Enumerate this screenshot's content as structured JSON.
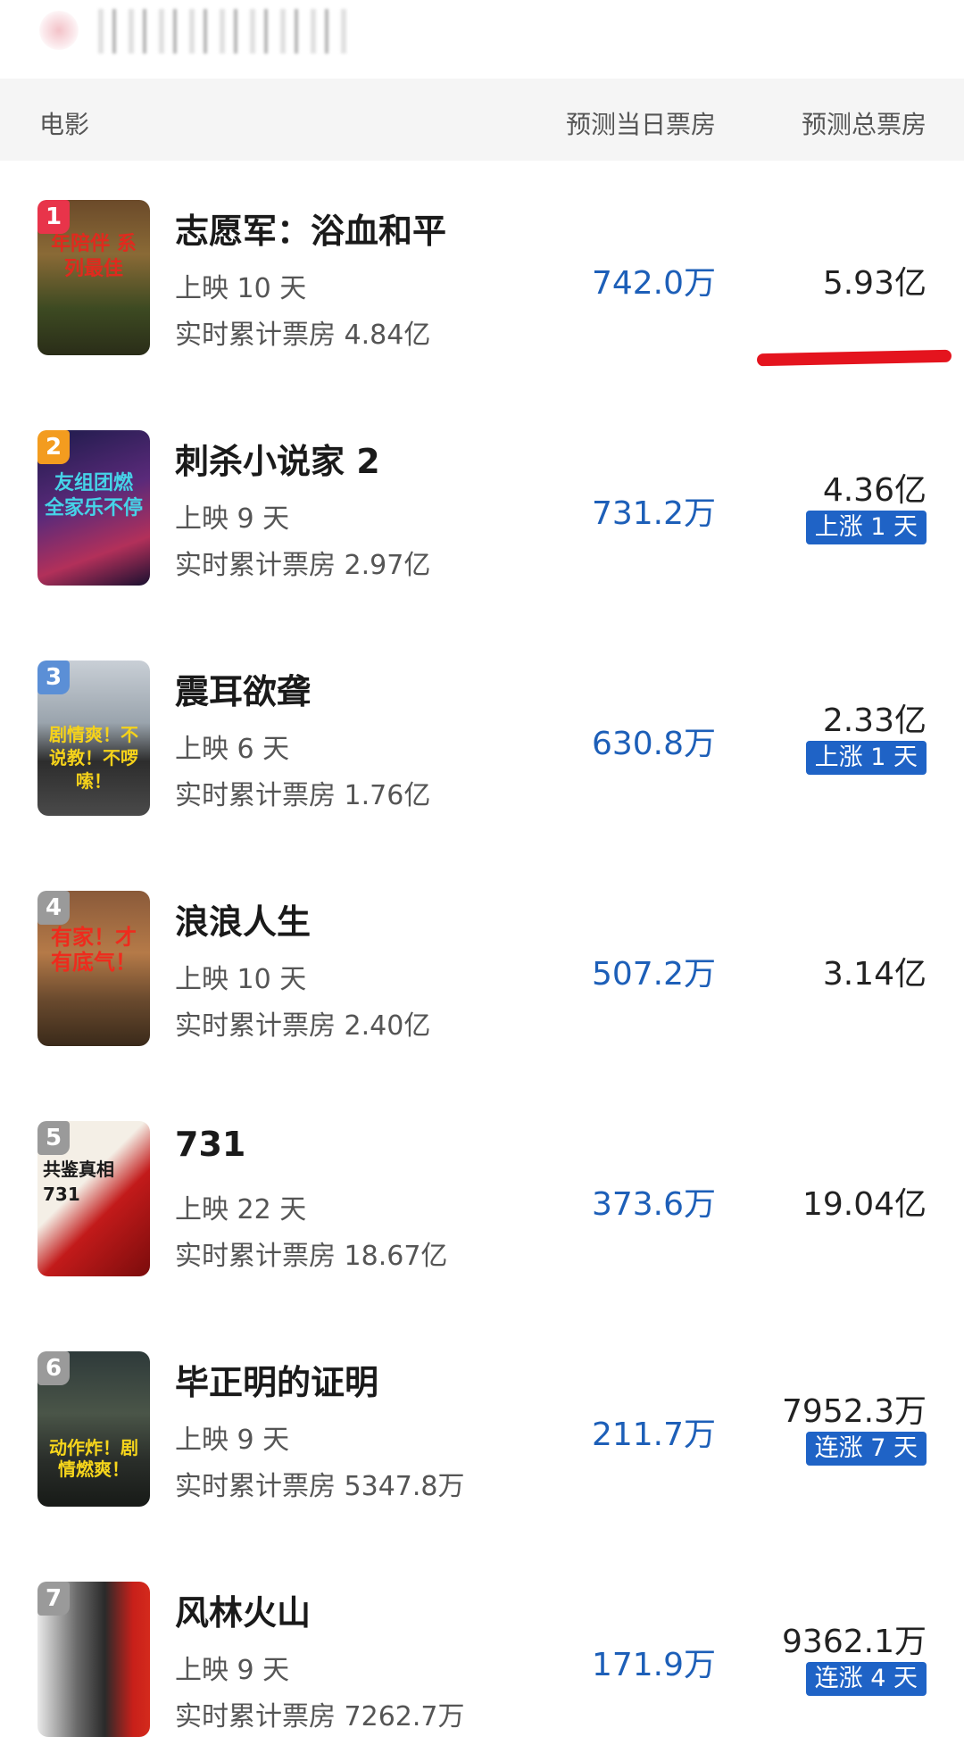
{
  "header": {
    "movie": "电影",
    "daily": "预测当日票房",
    "total": "预测总票房"
  },
  "colors": {
    "daily_value": "#1d5fb8",
    "badge_bg": "#1f63c6",
    "rank1": "#e8344a",
    "rank2": "#f39c1f",
    "rank3": "#5b8fd6",
    "rank_other": "#9a9a9a",
    "highlight_line": "#e4141e"
  },
  "movies": [
    {
      "rank": "1",
      "title": "志愿军：浴血和平",
      "days": "上映 10 天",
      "cum": "实时累计票房 4.84亿",
      "daily": "742.0万",
      "total": "5.93亿",
      "badge": "",
      "poster_text": "年陪伴 系列最佳"
    },
    {
      "rank": "2",
      "title": "刺杀小说家 2",
      "days": "上映 9 天",
      "cum": "实时累计票房 2.97亿",
      "daily": "731.2万",
      "total": "4.36亿",
      "badge": "上涨 1 天",
      "poster_text": "友组团燃 全家乐不停"
    },
    {
      "rank": "3",
      "title": "震耳欲聋",
      "days": "上映 6 天",
      "cum": "实时累计票房 1.76亿",
      "daily": "630.8万",
      "total": "2.33亿",
      "badge": "上涨 1 天",
      "poster_text": "剧情爽！不说教！不啰嗦！"
    },
    {
      "rank": "4",
      "title": "浪浪人生",
      "days": "上映 10 天",
      "cum": "实时累计票房 2.40亿",
      "daily": "507.2万",
      "total": "3.14亿",
      "badge": "",
      "poster_text": "有家！才有底气！"
    },
    {
      "rank": "5",
      "title": "731",
      "days": "上映 22 天",
      "cum": "实时累计票房 18.67亿",
      "daily": "373.6万",
      "total": "19.04亿",
      "badge": "",
      "poster_text": "共鉴真相 731"
    },
    {
      "rank": "6",
      "title": "毕正明的证明",
      "days": "上映 9 天",
      "cum": "实时累计票房 5347.8万",
      "daily": "211.7万",
      "total": "7952.3万",
      "badge": "连涨 7 天",
      "poster_text": "动作炸！剧情燃爽！"
    },
    {
      "rank": "7",
      "title": "风林火山",
      "days": "上映 9 天",
      "cum": "实时累计票房 7262.7万",
      "daily": "171.9万",
      "total": "9362.1万",
      "badge": "连涨 4 天",
      "poster_text": ""
    }
  ]
}
